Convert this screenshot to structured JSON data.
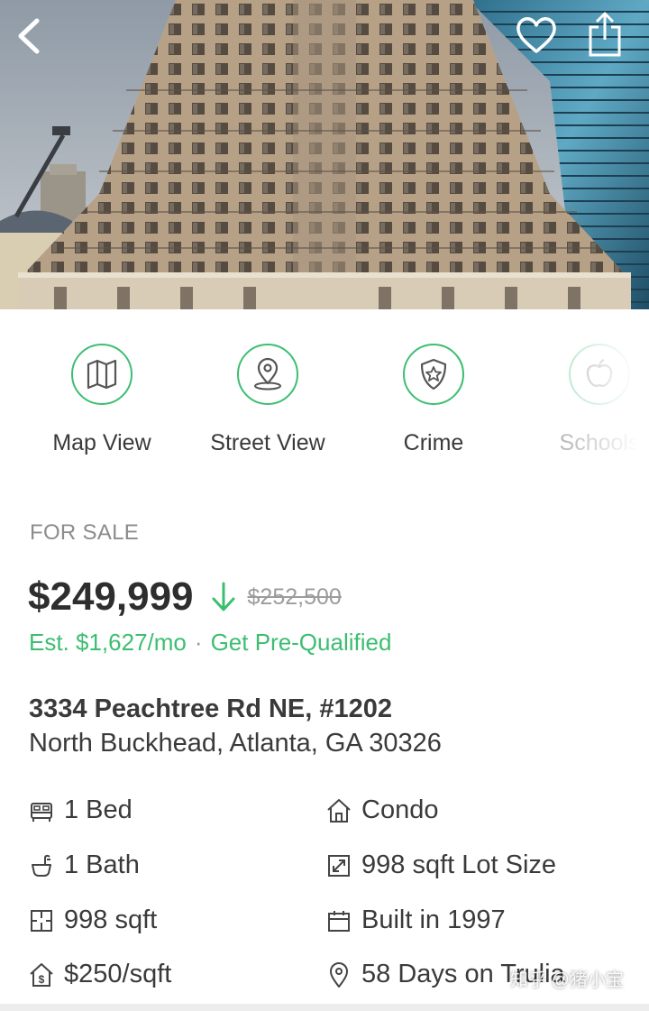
{
  "hero": {
    "icons": {
      "back": "chevron-left-icon",
      "favorite": "heart-outline-icon",
      "share": "share-icon"
    }
  },
  "actions": [
    {
      "label": "Map View",
      "icon": "map-icon"
    },
    {
      "label": "Street View",
      "icon": "location-pin-icon"
    },
    {
      "label": "Crime",
      "icon": "shield-star-icon"
    },
    {
      "label": "Schools",
      "icon": "apple-icon"
    }
  ],
  "listing": {
    "status": "FOR SALE",
    "price": "$249,999",
    "old_price": "$252,500",
    "estimate": "Est. $1,627/mo",
    "separator": "·",
    "prequalify": "Get Pre-Qualified",
    "address_line1": "3334 Peachtree Rd NE, #1202",
    "address_line2": "North Buckhead, Atlanta, GA 30326"
  },
  "facts": {
    "beds": "1 Bed",
    "type": "Condo",
    "baths": "1 Bath",
    "lot_size": "998 sqft Lot Size",
    "area": "998 sqft",
    "built": "Built in 1997",
    "price_per_sqft": "$250/sqft",
    "days_on": "58 Days on Trulia"
  },
  "watermark": "知乎 @猪小宝",
  "colors": {
    "accent": "#3cbe71",
    "text": "#3a3a3a",
    "muted": "#8c8c8c"
  }
}
